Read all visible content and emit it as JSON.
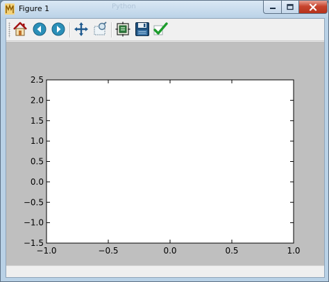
{
  "window": {
    "title": "Figure 1",
    "background_title": "Python"
  },
  "toolbar": {
    "buttons": [
      {
        "name": "home",
        "icon": "home-icon"
      },
      {
        "name": "back",
        "icon": "back-arrow-icon"
      },
      {
        "name": "forward",
        "icon": "forward-arrow-icon"
      },
      {
        "name": "pan",
        "icon": "pan-move-icon"
      },
      {
        "name": "zoom",
        "icon": "zoom-rect-icon"
      },
      {
        "name": "subplots",
        "icon": "configure-subplots-icon"
      },
      {
        "name": "save",
        "icon": "floppy-save-icon"
      },
      {
        "name": "edit",
        "icon": "checkmark-edit-icon"
      }
    ]
  },
  "statusbar": {
    "text": ""
  },
  "colors": {
    "canvas_bg": "#bfbfbf",
    "axes_bg": "#ffffff",
    "close_button": "#c7442e"
  },
  "chart_data": {
    "type": "line",
    "series": [],
    "title": "",
    "xlabel": "",
    "ylabel": "",
    "xlim": [
      -1.0,
      1.0
    ],
    "ylim": [
      -1.5,
      2.5
    ],
    "xticks": [
      "−1.0",
      "−0.5",
      "0.0",
      "0.5",
      "1.0"
    ],
    "yticks": [
      "−1.5",
      "−1.0",
      "−0.5",
      "0.0",
      "0.5",
      "1.0",
      "1.5",
      "2.0",
      "2.5"
    ],
    "xtick_values": [
      -1.0,
      -0.5,
      0.0,
      0.5,
      1.0
    ],
    "ytick_values": [
      -1.5,
      -1.0,
      -0.5,
      0.0,
      0.5,
      1.0,
      1.5,
      2.0,
      2.5
    ],
    "grid": false
  }
}
